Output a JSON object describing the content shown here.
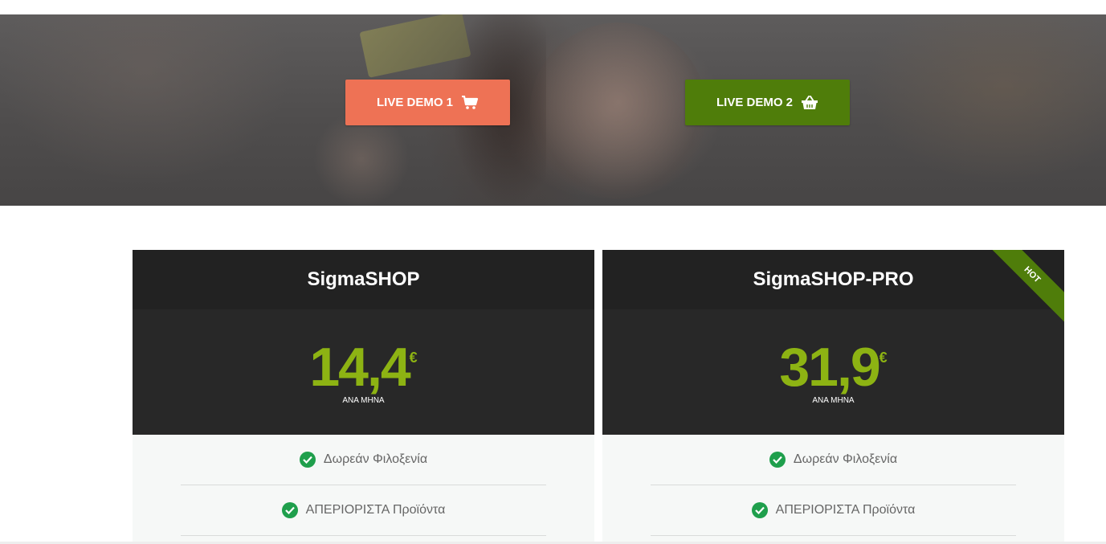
{
  "hero": {
    "demo1": {
      "label": "LIVE DEMO 1",
      "icon": "cart-icon",
      "color": "#ee7255"
    },
    "demo2": {
      "label": "LIVE DEMO 2",
      "icon": "basket-icon",
      "color": "#4f7d0a"
    }
  },
  "plans": [
    {
      "name": "SigmaSHOP",
      "price": "14,4",
      "currency": "€",
      "period": "ΑΝΑ ΜΗΝΑ",
      "features": [
        "Δωρεάν Φιλοξενία",
        "ΑΠΕΡΙΟΡΙΣΤΑ Προϊόντα"
      ]
    },
    {
      "name": "SigmaSHOP-PRO",
      "price": "31,9",
      "currency": "€",
      "period": "ΑΝΑ ΜΗΝΑ",
      "badge": "HOT",
      "features": [
        "Δωρεάν Φιλοξενία",
        "ΑΠΕΡΙΟΡΙΣΤΑ Προϊόντα"
      ]
    }
  ],
  "colors": {
    "price_accent": "#8db313",
    "check": "#1f9f4c",
    "header_bg": "#222222"
  }
}
